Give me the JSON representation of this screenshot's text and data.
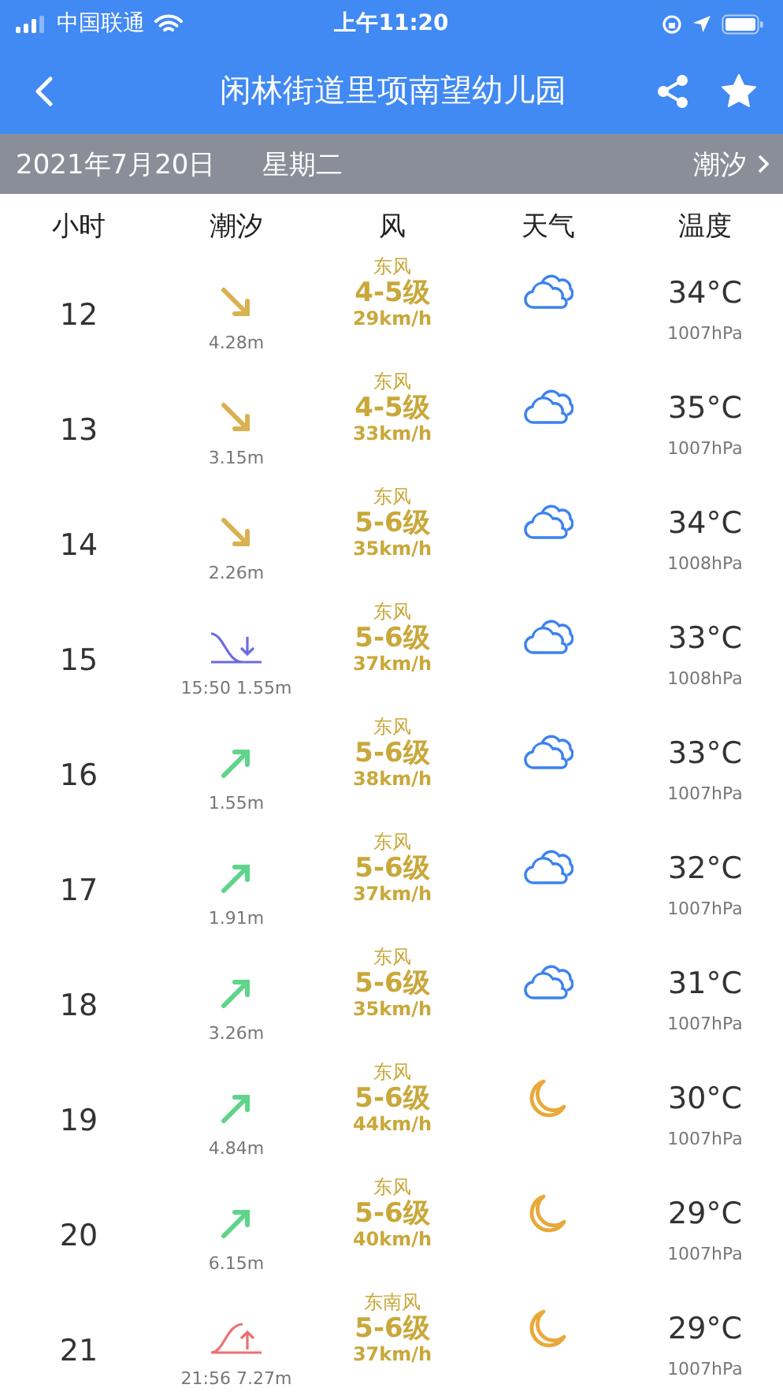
{
  "status_bar": {
    "carrier": "中国联通",
    "time": "上午11:20"
  },
  "nav": {
    "title": "闲林街道里项南望幼儿园"
  },
  "date_bar": {
    "date": "2021年7月20日",
    "weekday": "星期二",
    "link": "潮汐"
  },
  "columns": [
    "小时",
    "潮汐",
    "风",
    "天气",
    "温度"
  ],
  "rows": [
    {
      "hour": "12",
      "tide": {
        "kind": "falling",
        "text": "4.28m"
      },
      "wind_dir": "东风",
      "wind_level": "4-5级",
      "wind_speed": "29km/h",
      "weather": {
        "kind": "cloudy"
      },
      "temp": "34°C",
      "pressure": "1007hPa"
    },
    {
      "hour": "13",
      "tide": {
        "kind": "falling",
        "text": "3.15m"
      },
      "wind_dir": "东风",
      "wind_level": "4-5级",
      "wind_speed": "33km/h",
      "weather": {
        "kind": "cloudy"
      },
      "temp": "35°C",
      "pressure": "1007hPa"
    },
    {
      "hour": "14",
      "tide": {
        "kind": "falling",
        "text": "2.26m"
      },
      "wind_dir": "东风",
      "wind_level": "5-6级",
      "wind_speed": "35km/h",
      "weather": {
        "kind": "cloudy"
      },
      "temp": "34°C",
      "pressure": "1008hPa"
    },
    {
      "hour": "15",
      "tide": {
        "kind": "low",
        "text": "15:50 1.55m"
      },
      "wind_dir": "东风",
      "wind_level": "5-6级",
      "wind_speed": "37km/h",
      "weather": {
        "kind": "cloudy"
      },
      "temp": "33°C",
      "pressure": "1008hPa"
    },
    {
      "hour": "16",
      "tide": {
        "kind": "rising",
        "text": "1.55m"
      },
      "wind_dir": "东风",
      "wind_level": "5-6级",
      "wind_speed": "38km/h",
      "weather": {
        "kind": "cloudy"
      },
      "temp": "33°C",
      "pressure": "1007hPa"
    },
    {
      "hour": "17",
      "tide": {
        "kind": "rising",
        "text": "1.91m"
      },
      "wind_dir": "东风",
      "wind_level": "5-6级",
      "wind_speed": "37km/h",
      "weather": {
        "kind": "cloudy"
      },
      "temp": "32°C",
      "pressure": "1007hPa"
    },
    {
      "hour": "18",
      "tide": {
        "kind": "rising",
        "text": "3.26m"
      },
      "wind_dir": "东风",
      "wind_level": "5-6级",
      "wind_speed": "35km/h",
      "weather": {
        "kind": "cloudy"
      },
      "temp": "31°C",
      "pressure": "1007hPa"
    },
    {
      "hour": "19",
      "tide": {
        "kind": "rising",
        "text": "4.84m"
      },
      "wind_dir": "东风",
      "wind_level": "5-6级",
      "wind_speed": "44km/h",
      "weather": {
        "kind": "night"
      },
      "temp": "30°C",
      "pressure": "1007hPa"
    },
    {
      "hour": "20",
      "tide": {
        "kind": "rising",
        "text": "6.15m"
      },
      "wind_dir": "东风",
      "wind_level": "5-6级",
      "wind_speed": "40km/h",
      "weather": {
        "kind": "night"
      },
      "temp": "29°C",
      "pressure": "1007hPa"
    },
    {
      "hour": "21",
      "tide": {
        "kind": "high",
        "text": "21:56 7.27m"
      },
      "wind_dir": "东南风",
      "wind_level": "5-6级",
      "wind_speed": "37km/h",
      "weather": {
        "kind": "night"
      },
      "temp": "29°C",
      "pressure": "1007hPa"
    }
  ]
}
